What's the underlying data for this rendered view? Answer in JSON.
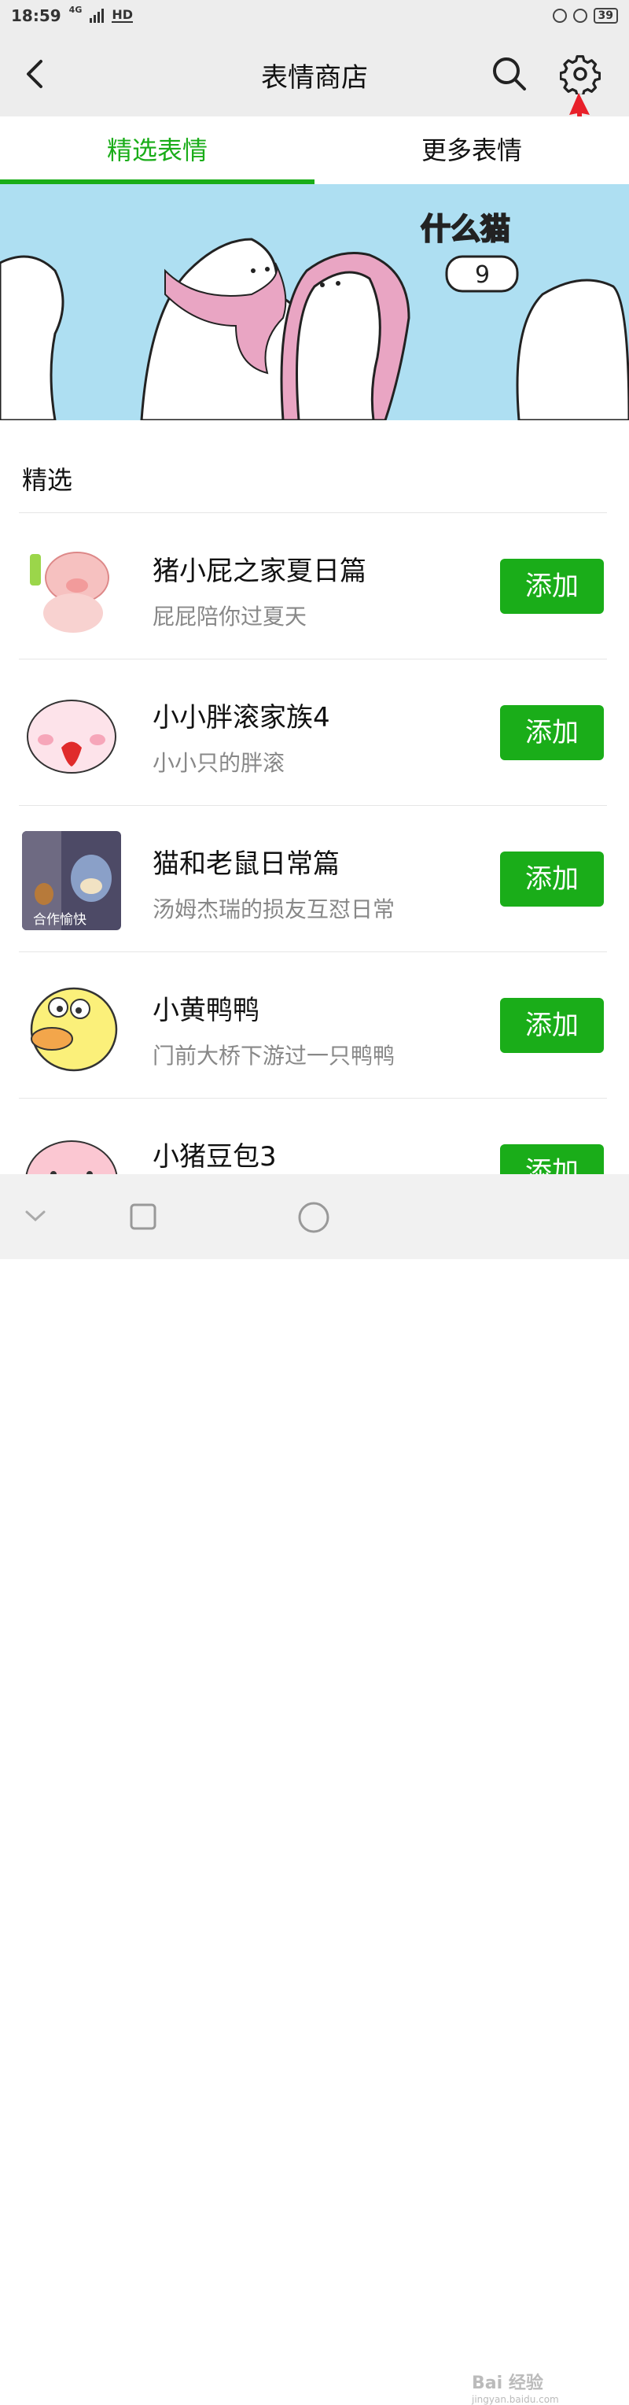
{
  "status_bar": {
    "time": "18:59",
    "network": "4G",
    "hd": "HD",
    "battery": "39"
  },
  "header": {
    "title": "表情商店"
  },
  "tabs": [
    {
      "label": "精选表情",
      "active": true
    },
    {
      "label": "更多表情",
      "active": false
    }
  ],
  "banner": {
    "text": "什么猫",
    "number": "9"
  },
  "section": {
    "title": "精选"
  },
  "items": [
    {
      "name": "猪小屁之家夏日篇",
      "desc": "屁屁陪你过夏天",
      "button": "添加"
    },
    {
      "name": "小小胖滚家族4",
      "desc": "小小只的胖滚",
      "button": "添加"
    },
    {
      "name": "猫和老鼠日常篇",
      "desc": "汤姆杰瑞的损友互怼日常",
      "button": "添加",
      "thumb_text": "合作愉快"
    },
    {
      "name": "小黄鸭鸭",
      "desc": "门前大桥下游过一只鸭鸭",
      "button": "添加"
    },
    {
      "name": "小猪豆包3",
      "desc": "",
      "button": "添加"
    }
  ],
  "watermark": {
    "brand": "Bai 经验",
    "url": "jingyan.baidu.com"
  },
  "colors": {
    "accent": "#1aad19",
    "banner_bg": "#aedff2",
    "header_bg": "#ededed",
    "arrow": "#e8202a"
  }
}
